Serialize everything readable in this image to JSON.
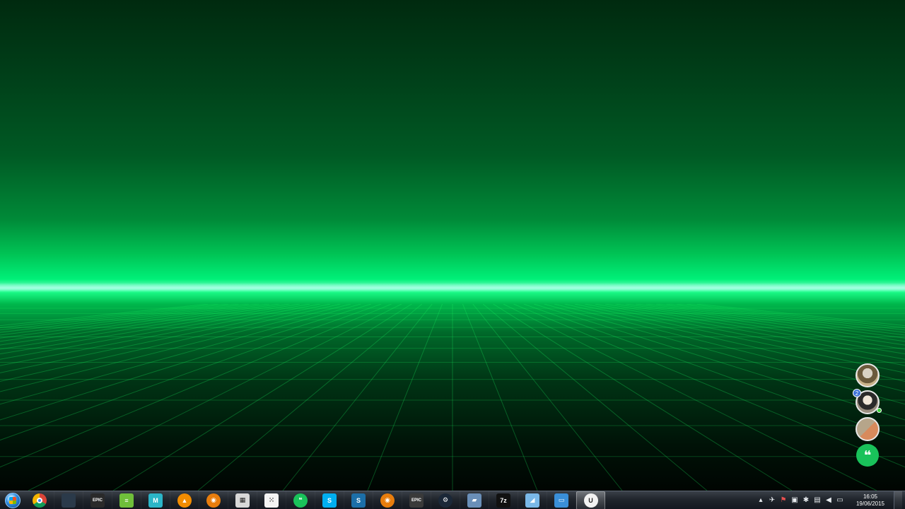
{
  "desktop": {
    "wallpaper": "green-horizon-grid",
    "colors": {
      "horizon": "#1cff8a",
      "sky_top": "#002a0f",
      "floor": "#000502",
      "grid_line": "#1aff66"
    }
  },
  "chatheads": {
    "items": [
      {
        "name": "chathead-1"
      },
      {
        "name": "chathead-2",
        "badge": "2"
      },
      {
        "name": "chathead-3"
      }
    ],
    "bubble_icon": "hangouts-icon"
  },
  "taskbar": {
    "start_icon": "windows-start-orb-icon",
    "apps": [
      {
        "name": "chrome",
        "icon": "chrome-icon",
        "glyph": "",
        "color": "#db4437"
      },
      {
        "name": "steam-overlay",
        "icon": "steam-icon",
        "glyph": "",
        "color": "#2b3a4a"
      },
      {
        "name": "epic-launcher",
        "icon": "epic-games-icon",
        "glyph": "EPIC",
        "color": "#2a2a2a"
      },
      {
        "name": "notepad",
        "icon": "notepad-icon",
        "glyph": "≡",
        "color": "#6fbf3a"
      },
      {
        "name": "marvelous",
        "icon": "marvelous-icon",
        "glyph": "M",
        "color": "#2bb5c8"
      },
      {
        "name": "vlc",
        "icon": "vlc-icon",
        "glyph": "▲",
        "color": "#f28c00"
      },
      {
        "name": "blender",
        "icon": "blender-icon",
        "glyph": "◉",
        "color": "#e87d0d"
      },
      {
        "name": "calculator",
        "icon": "calculator-icon",
        "glyph": "▦",
        "color": "#d8d8d8"
      },
      {
        "name": "apps-grid",
        "icon": "apps-grid-icon",
        "glyph": "⁙",
        "color": "#f4f4f4"
      },
      {
        "name": "hangouts",
        "icon": "hangouts-icon",
        "glyph": "❝",
        "color": "#19c25a"
      },
      {
        "name": "skype",
        "icon": "skype-icon",
        "glyph": "S",
        "color": "#00aff0"
      },
      {
        "name": "substance",
        "icon": "substance-icon",
        "glyph": "S",
        "color": "#1c6fa8"
      },
      {
        "name": "blender-2",
        "icon": "blender-icon",
        "glyph": "◉",
        "color": "#e87d0d"
      },
      {
        "name": "epic-launcher-2",
        "icon": "epic-games-icon",
        "glyph": "EPIC",
        "color": "#3a3a3a"
      },
      {
        "name": "steam",
        "icon": "steam-icon",
        "glyph": "⚙",
        "color": "#1b2838"
      },
      {
        "name": "photo-viewer",
        "icon": "photo-viewer-icon",
        "glyph": "▰",
        "color": "#6a8fb8"
      },
      {
        "name": "7zip",
        "icon": "7zip-icon",
        "glyph": "7z",
        "color": "#111111"
      },
      {
        "name": "paint",
        "icon": "paint-icon",
        "glyph": "◢",
        "color": "#7ab8e8"
      },
      {
        "name": "explorer",
        "icon": "window-icon",
        "glyph": "▭",
        "color": "#3a8fd8"
      },
      {
        "name": "unreal-engine",
        "icon": "unreal-engine-icon",
        "glyph": "U",
        "color": "#f2f2f2",
        "active": true
      }
    ],
    "tray": {
      "icons": [
        "chevron-up-icon",
        "network-icon",
        "flag-icon",
        "security-icon",
        "gear-icon",
        "display-icon",
        "volume-icon",
        "monitor-icon"
      ]
    },
    "clock": {
      "time": "16:05",
      "date": "19/06/2015"
    }
  }
}
